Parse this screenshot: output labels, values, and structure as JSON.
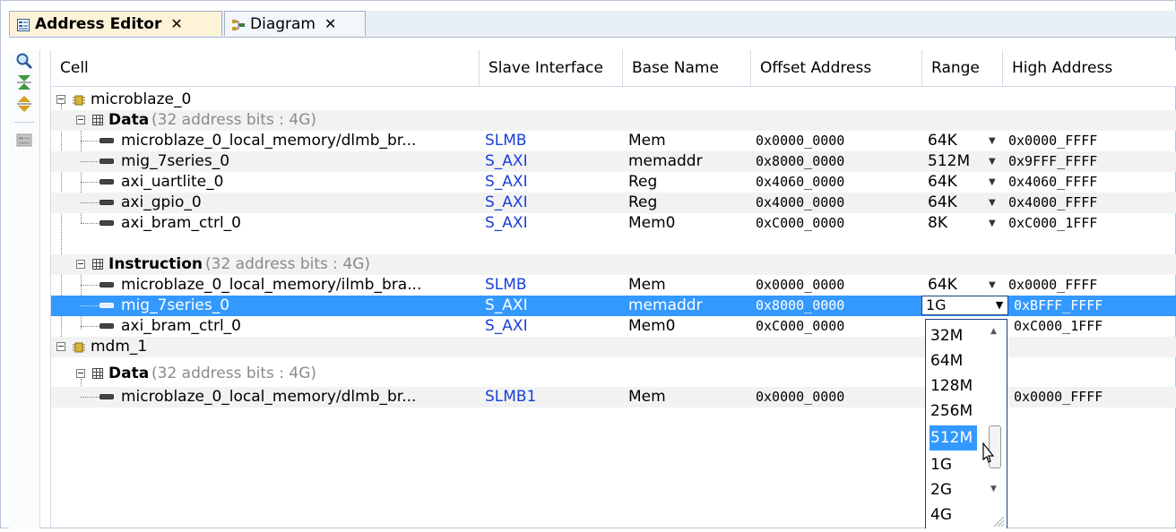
{
  "tabs": [
    {
      "label": "Address Editor",
      "icon": "address-editor-icon"
    },
    {
      "label": "Diagram",
      "icon": "diagram-icon"
    }
  ],
  "tab_close_glyph": "✕",
  "toolbar": [
    {
      "icon": "search-icon"
    },
    {
      "icon": "collapse-all-icon"
    },
    {
      "icon": "expand-all-icon"
    },
    {
      "icon": "auto-assign-icon"
    }
  ],
  "columns": [
    "Cell",
    "Slave Interface",
    "Base Name",
    "Offset Address",
    "Range",
    "High Address"
  ],
  "tree": {
    "master1": "microblaze_0",
    "data_label": "Data",
    "data_info": "(32 address bits : 4G)",
    "instr_label": "Instruction",
    "instr_info": "(32 address bits : 4G)",
    "master2": "mdm_1",
    "data2_label": "Data",
    "data2_info": "(32 address bits : 4G)"
  },
  "rows": [
    {
      "cell": "microblaze_0_local_memory/dlmb_br...",
      "iface": "SLMB",
      "base": "Mem",
      "offset": "0x0000_0000",
      "range": "64K",
      "high": "0x0000_FFFF"
    },
    {
      "cell": "mig_7series_0",
      "iface": "S_AXI",
      "base": "memaddr",
      "offset": "0x8000_0000",
      "range": "512M",
      "high": "0x9FFF_FFFF"
    },
    {
      "cell": "axi_uartlite_0",
      "iface": "S_AXI",
      "base": "Reg",
      "offset": "0x4060_0000",
      "range": "64K",
      "high": "0x4060_FFFF"
    },
    {
      "cell": "axi_gpio_0",
      "iface": "S_AXI",
      "base": "Reg",
      "offset": "0x4000_0000",
      "range": "64K",
      "high": "0x4000_FFFF"
    },
    {
      "cell": "axi_bram_ctrl_0",
      "iface": "S_AXI",
      "base": "Mem0",
      "offset": "0xC000_0000",
      "range": "8K",
      "high": "0xC000_1FFF"
    },
    {
      "cell": "microblaze_0_local_memory/ilmb_bra...",
      "iface": "SLMB",
      "base": "Mem",
      "offset": "0x0000_0000",
      "range": "64K",
      "high": "0x0000_FFFF"
    },
    {
      "cell": "mig_7series_0",
      "iface": "S_AXI",
      "base": "memaddr",
      "offset": "0x8000_0000",
      "range": "1G",
      "high": "0xBFFF_FFFF"
    },
    {
      "cell": "axi_bram_ctrl_0",
      "iface": "S_AXI",
      "base": "Mem0",
      "offset": "0xC000_0000",
      "range": "",
      "high": "0xC000_1FFF"
    },
    {
      "cell": "microblaze_0_local_memory/dlmb_br...",
      "iface": "SLMB1",
      "base": "Mem",
      "offset": "0x0000_0000",
      "range": "",
      "high": "0x0000_FFFF"
    }
  ],
  "dropdown": {
    "selected": "1G",
    "options": [
      "32M",
      "64M",
      "128M",
      "256M",
      "512M",
      "1G",
      "2G",
      "4G"
    ],
    "highlighted": "512M"
  },
  "colors": {
    "selection": "#3399ff",
    "link": "#1a3fd6",
    "active_tab": "#fdf3d8"
  }
}
